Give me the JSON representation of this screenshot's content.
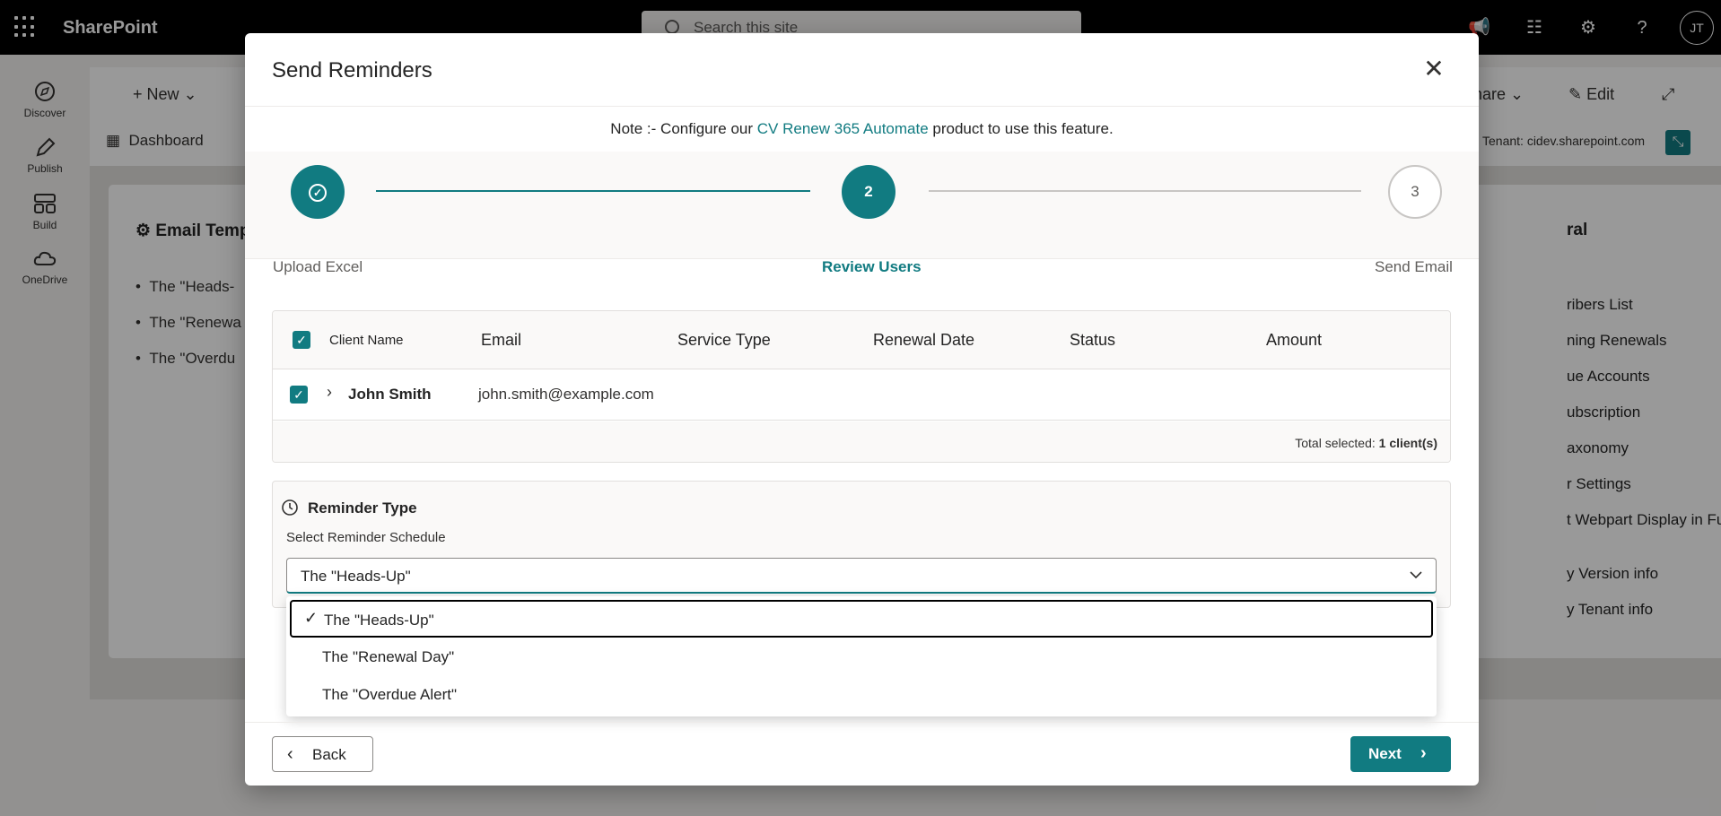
{
  "suite": {
    "brand": "SharePoint",
    "search_placeholder": "Search this site",
    "avatar_initials": "JT"
  },
  "rail": [
    {
      "label": "Discover",
      "icon": "compass-icon"
    },
    {
      "label": "Publish",
      "icon": "pen-icon"
    },
    {
      "label": "Build",
      "icon": "grid-icon"
    },
    {
      "label": "OneDrive",
      "icon": "cloud-icon"
    }
  ],
  "background_page": {
    "new_label": "New",
    "share_label": "hare",
    "edit_label": "Edit",
    "dashboard_label": "Dashboard",
    "tenant_label": "Tenant: cidev.sharepoint.com",
    "card_left_title": "Email Temp",
    "card_left_items": [
      "The \"Heads-",
      "The \"Renewa",
      "The \"Overdu"
    ],
    "card_right_title": "ral",
    "card_right_items": [
      "ribers List",
      "ning Renewals",
      "ue Accounts",
      "ubscription",
      "axonomy",
      "r Settings",
      "t Webpart Display in Full",
      "y Version info",
      "y Tenant info"
    ]
  },
  "modal": {
    "title": "Send Reminders",
    "note_prefix": "Note :- Configure our ",
    "note_link": "CV Renew 365 Automate",
    "note_suffix": " product to use this feature.",
    "steps": [
      {
        "number": "",
        "label": "Upload Excel",
        "state": "done"
      },
      {
        "number": "2",
        "label": "Review Users",
        "state": "active"
      },
      {
        "number": "3",
        "label": "Send Email",
        "state": "pending"
      }
    ],
    "table": {
      "columns": [
        "Client Name",
        "Email",
        "Service Type",
        "Renewal Date",
        "Status",
        "Amount"
      ],
      "rows": [
        {
          "name": "John Smith",
          "email": "john.smith@example.com",
          "service_type": "",
          "renewal_date": "",
          "status": "",
          "amount": ""
        }
      ],
      "total_prefix": "Total selected: ",
      "total_value": "1 client(s)"
    },
    "reminder": {
      "title": "Reminder Type",
      "subtitle": "Select Reminder Schedule",
      "selected": "The \"Heads-Up\"",
      "options": [
        "The \"Heads-Up\"",
        "The \"Renewal Day\"",
        "The \"Overdue Alert\""
      ]
    },
    "back_label": "Back",
    "next_label": "Next"
  },
  "colors": {
    "accent": "#117b81",
    "suite_bar": "#000000"
  }
}
